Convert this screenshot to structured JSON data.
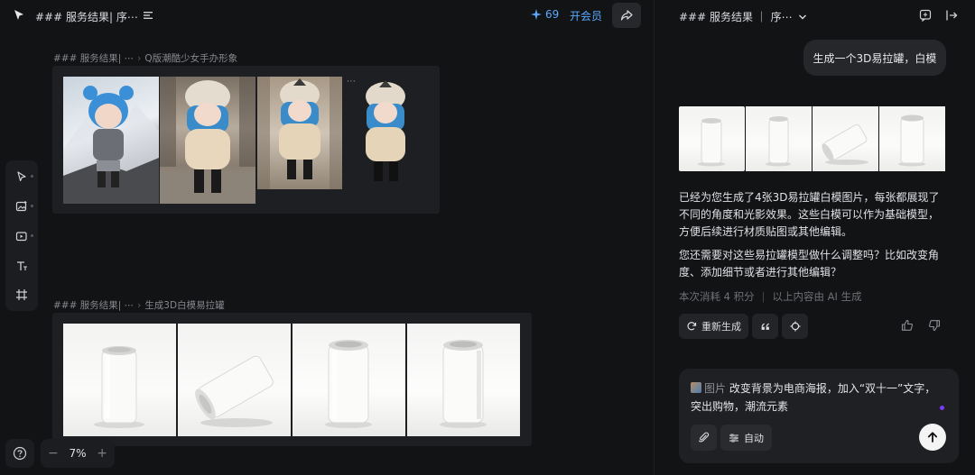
{
  "header": {
    "doc_title": "### 服务结果|  序⋯",
    "credits": "69",
    "vip_label": "开会员"
  },
  "canvas": {
    "group1": {
      "label_a": "### 服务结果|  ⋯",
      "label_b": "Q版潮酷少女手办形象",
      "overflow": "⋯"
    },
    "group2": {
      "label_a": "### 服务结果|  ⋯",
      "label_b": "生成3D白模易拉罐"
    },
    "zoom": "7%",
    "zoom_minus": "−",
    "zoom_plus": "+"
  },
  "chat": {
    "title": "### 服务结果 ｜ 序⋯",
    "user_message": "生成一个3D易拉罐，白模",
    "reply_p1": "已经为您生成了4张3D易拉罐白模图片，每张都展现了不同的角度和光影效果。这些白模可以作为基础模型，方便后续进行材质贴图或其他编辑。",
    "reply_p2": "您还需要对这些易拉罐模型做什么调整吗？比如改变角度、添加细节或者进行其他编辑？",
    "meta_cost": "本次消耗 4 积分",
    "meta_sep": "|",
    "meta_ai": "以上内容由 AI 生成",
    "regen_label": "重新生成",
    "composer": {
      "tag": "图片",
      "text": "改变背景为电商海报，加入“双十一”文字，突出购物，潮流元素",
      "auto_label": "自动"
    }
  },
  "colors": {
    "accent": "#5aa9ff",
    "background": "#121315",
    "panel": "#1e1f22",
    "purple_dot": "#7a3cff"
  }
}
